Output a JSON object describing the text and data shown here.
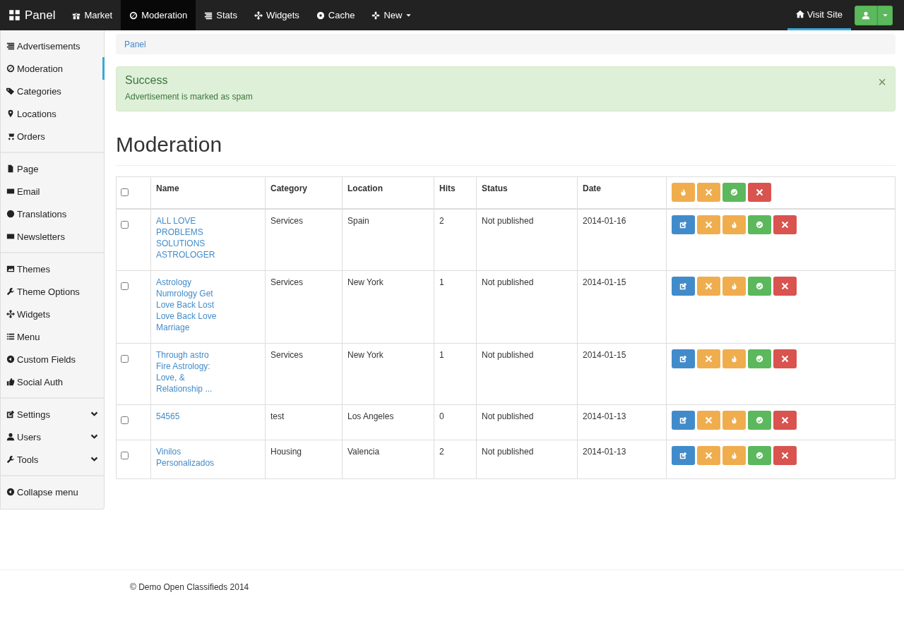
{
  "navbar": {
    "brand": "Panel",
    "items": [
      {
        "label": "Market",
        "selected": false,
        "kind": "link"
      },
      {
        "label": "Moderation",
        "selected": true,
        "kind": "link"
      },
      {
        "label": "Stats",
        "selected": false,
        "kind": "link"
      },
      {
        "label": "Widgets",
        "selected": false,
        "kind": "link"
      },
      {
        "label": "Cache",
        "selected": false,
        "kind": "link"
      },
      {
        "label": "New",
        "selected": false,
        "kind": "dropdown"
      }
    ],
    "visit_site": {
      "label": "Visit Site",
      "highlighted": true
    }
  },
  "sidebar": {
    "groups": [
      {
        "items": [
          {
            "label": "Advertisements",
            "selected": false,
            "kind": "link"
          },
          {
            "label": "Moderation",
            "selected": true,
            "kind": "link"
          },
          {
            "label": "Categories",
            "selected": false,
            "kind": "link"
          },
          {
            "label": "Locations",
            "selected": false,
            "kind": "link"
          },
          {
            "label": "Orders",
            "selected": false,
            "kind": "link"
          }
        ]
      },
      {
        "items": [
          {
            "label": "Page",
            "selected": false,
            "kind": "link"
          },
          {
            "label": "Email",
            "selected": false,
            "kind": "link"
          },
          {
            "label": "Translations",
            "selected": false,
            "kind": "link"
          },
          {
            "label": "Newsletters",
            "selected": false,
            "kind": "link"
          }
        ]
      },
      {
        "items": [
          {
            "label": "Themes",
            "selected": false,
            "kind": "link"
          },
          {
            "label": "Theme Options",
            "selected": false,
            "kind": "link"
          },
          {
            "label": "Widgets",
            "selected": false,
            "kind": "link"
          },
          {
            "label": "Menu",
            "selected": false,
            "kind": "link"
          },
          {
            "label": "Custom Fields",
            "selected": false,
            "kind": "link"
          },
          {
            "label": "Social Auth",
            "selected": false,
            "kind": "link"
          }
        ]
      },
      {
        "items": [
          {
            "label": "Settings",
            "selected": false,
            "kind": "submenu"
          },
          {
            "label": "Users",
            "selected": false,
            "kind": "submenu"
          },
          {
            "label": "Tools",
            "selected": false,
            "kind": "submenu"
          }
        ]
      },
      {
        "items": [
          {
            "label": "Collapse menu",
            "selected": false,
            "kind": "link"
          }
        ]
      }
    ]
  },
  "breadcrumb": [
    "Panel"
  ],
  "alert": {
    "title": "Success",
    "message": "Advertisement is marked as spam",
    "close": "×"
  },
  "heading": "Moderation",
  "table": {
    "columns": [
      "Name",
      "Category",
      "Location",
      "Hits",
      "Status",
      "Date"
    ],
    "header_checked": false,
    "header_actions": [
      {
        "kind": "feature"
      },
      {
        "kind": "spam"
      },
      {
        "kind": "activate"
      },
      {
        "kind": "delete"
      }
    ],
    "row_actions": [
      {
        "kind": "edit"
      },
      {
        "kind": "spam"
      },
      {
        "kind": "feature"
      },
      {
        "kind": "activate"
      },
      {
        "kind": "delete"
      }
    ],
    "rows": [
      {
        "checked": false,
        "name": "ALL LOVE PROBLEMS SOLUTIONS ASTROLOGER",
        "category": "Services",
        "location": "Spain",
        "hits": "2",
        "status": "Not published",
        "date": "2014-01-16"
      },
      {
        "checked": false,
        "name": "Astrology Numrology Get Love Back Lost Love Back Love Marriage",
        "category": "Services",
        "location": "New York",
        "hits": "1",
        "status": "Not published",
        "date": "2014-01-15"
      },
      {
        "checked": false,
        "name": "Through astro Fire Astrology: Love, & Relationship ...",
        "category": "Services",
        "location": "New York",
        "hits": "1",
        "status": "Not published",
        "date": "2014-01-15"
      },
      {
        "checked": false,
        "name": "54565",
        "category": "test",
        "location": "Los Angeles",
        "hits": "0",
        "status": "Not published",
        "date": "2014-01-13"
      },
      {
        "checked": false,
        "name": "Vinilos Personalizados",
        "category": "Housing",
        "location": "Valencia",
        "hits": "2",
        "status": "Not published",
        "date": "2014-01-13"
      }
    ]
  },
  "footer": "© Demo Open Classifieds 2014"
}
